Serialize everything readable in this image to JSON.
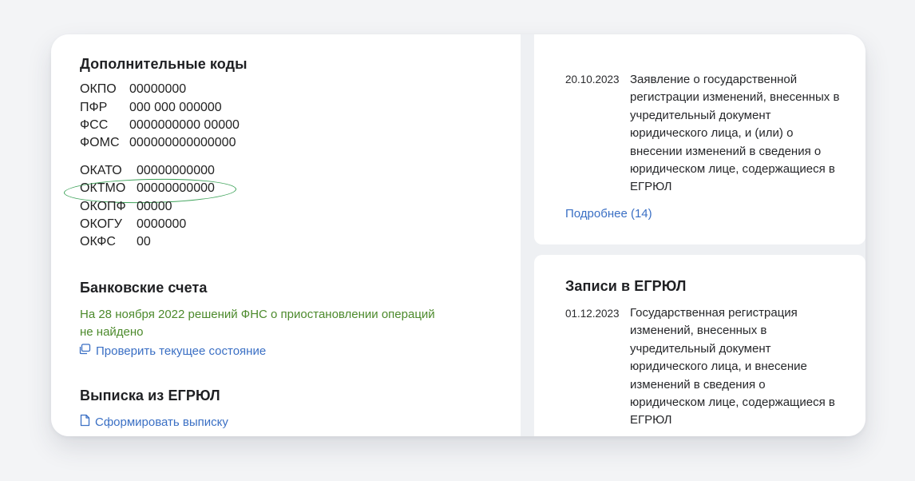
{
  "additional_codes": {
    "title": "Дополнительные коды",
    "group1": [
      {
        "label": "ОКПО",
        "value": "00000000"
      },
      {
        "label": "ПФР",
        "value": "000 000 000000"
      },
      {
        "label": "ФСС",
        "value": "0000000000 00000"
      },
      {
        "label": "ФОМС",
        "value": "000000000000000"
      }
    ],
    "group2": [
      {
        "label": "ОКАТО",
        "value": "00000000000"
      },
      {
        "label": "ОКТМО",
        "value": "00000000000"
      },
      {
        "label": "ОКОПФ",
        "value": "00000"
      },
      {
        "label": "ОКОГУ",
        "value": "0000000"
      },
      {
        "label": "ОКФС",
        "value": "00"
      }
    ],
    "highlight_color": "#3ea35a"
  },
  "bank_accounts": {
    "title": "Банковские счета",
    "status_line1": "На 28 ноября 2022 решений ФНС о приостановлении операций",
    "status_line2": "не найдено",
    "check_link": "Проверить текущее состояние"
  },
  "egrul_extract": {
    "title": "Выписка из ЕГРЮЛ",
    "generate_link": "Сформировать выписку"
  },
  "changes_card": {
    "date": "20.10.2023",
    "description_lines": [
      "Заявление о государственной",
      "регистрации изменений, внесенных в",
      "учредительный документ",
      "юридического лица, и (или) о",
      "внесении изменений в сведения о",
      "юридическом лице, содержащиеся в",
      "ЕГРЮЛ"
    ],
    "more_link": "Подробнее (14)"
  },
  "egrul_records": {
    "title": "Записи в ЕГРЮЛ",
    "date": "01.12.2023",
    "description_lines": [
      "Государственная регистрация",
      "изменений, внесенных в",
      "учредительный документ",
      "юридического лица, и внесение",
      "изменений в сведения о",
      "юридическом лице, содержащиеся в",
      "ЕГРЮЛ"
    ]
  },
  "colors": {
    "link": "#3a6fc4",
    "status_green": "#4c8a2c",
    "highlight": "#3ea35a"
  },
  "icons": {
    "check_link_icon": "copy-icon",
    "generate_link_icon": "document-icon"
  }
}
